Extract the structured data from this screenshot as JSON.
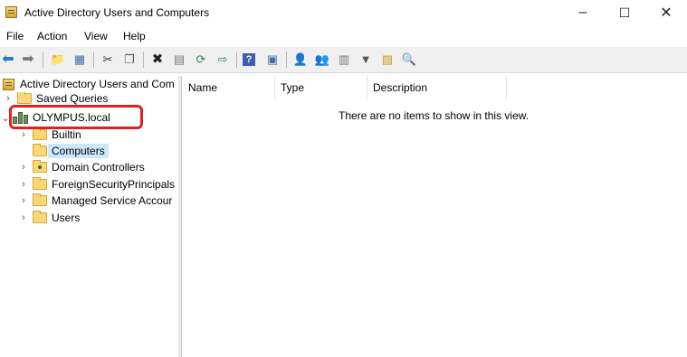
{
  "window": {
    "title": "Active Directory Users and Computers",
    "minimize": "–",
    "maximize": "☐",
    "close": "✕"
  },
  "menu": [
    "File",
    "Action",
    "View",
    "Help"
  ],
  "toolbar_icons": [
    "back",
    "forward",
    "up-folder",
    "show-hide-console-tree",
    "cut",
    "copy",
    "delete",
    "properties",
    "refresh",
    "export-list",
    "help",
    "action-pane",
    "new-user",
    "new-group",
    "new-ou",
    "filter",
    "add-to-group",
    "find"
  ],
  "tree": {
    "root": "Active Directory Users and Com",
    "saved_queries": "Saved Queries",
    "domain": "OLYMPUS.local",
    "children": [
      "Builtin",
      "Computers",
      "Domain Controllers",
      "ForeignSecurityPrincipals",
      "Managed Service Accour",
      "Users"
    ],
    "selected": "Computers"
  },
  "list": {
    "columns": [
      "Name",
      "Type",
      "Description"
    ],
    "empty_message": "There are no items to show in this view."
  },
  "colors": {
    "highlight": "#e32020",
    "selection": "#cce8ff"
  }
}
